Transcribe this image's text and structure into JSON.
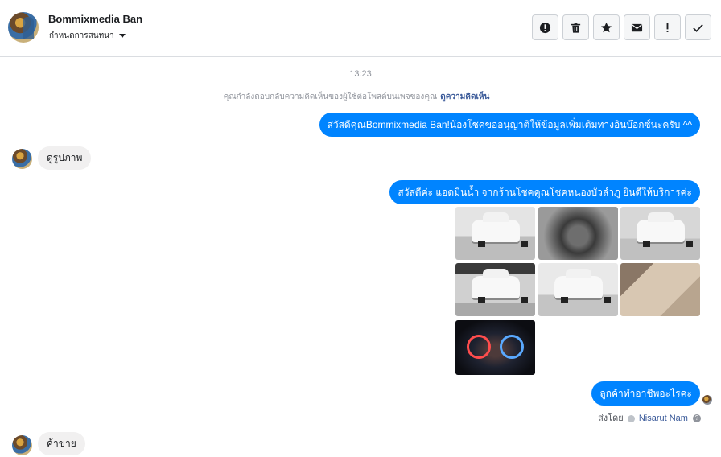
{
  "header": {
    "contact_name": "Bommixmedia Ban",
    "assign_label": "กำหนดการสนทนา"
  },
  "actions": [
    {
      "name": "spam-button",
      "icon": "alert-circle-icon"
    },
    {
      "name": "delete-button",
      "icon": "trash-icon"
    },
    {
      "name": "star-button",
      "icon": "star-icon"
    },
    {
      "name": "mark-unread-button",
      "icon": "envelope-icon"
    },
    {
      "name": "flag-button",
      "icon": "exclamation-icon"
    },
    {
      "name": "done-button",
      "icon": "check-icon"
    }
  ],
  "conversation": {
    "timestamp": "13:23",
    "notice_text": "คุณกำลังตอบกลับความคิดเห็นของผู้ใช้ต่อโพสต์บนเพจของคุณ",
    "notice_link": "ดูความคิดเห็น",
    "messages": {
      "out_1": "สวัสดีคุณBommixmedia Ban!น้องโชคขออนุญาติให้ข้อมูลเพิ่มเติมทางอินบ๊อกซ์นะครับ ^^",
      "in_1": "ดูรูปภาพ",
      "out_2": "สวัสดีค่ะ แอดมินน้ำ จากร้านโชคคูณโชคหนองบัวลำภู ยินดีให้บริการค่ะ",
      "out_3": "ลูกค้าทำอาชีพอะไรคะ",
      "in_2": "ค้าขาย"
    },
    "photo_count": 7,
    "sent_by_label": "ส่งโดย",
    "sent_by_name": "Nisarut Nam"
  },
  "colors": {
    "outgoing_bubble": "#0084ff",
    "incoming_bubble": "#f1f0f0",
    "link": "#385898"
  }
}
